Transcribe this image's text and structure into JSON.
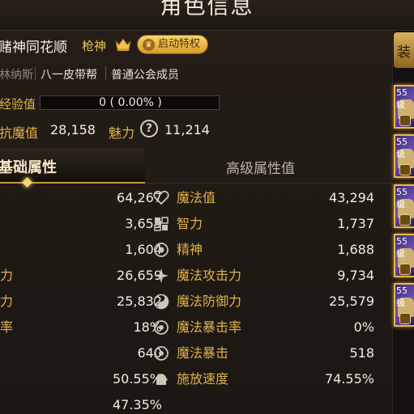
{
  "window": {
    "title": "角色信息"
  },
  "profile": {
    "name": "赌神同花顺",
    "job": "枪神",
    "start_button": "启动特权",
    "tags": [
      "林纳斯",
      "八一皮带帮",
      "普通公会成员"
    ]
  },
  "exp": {
    "label": "经验值",
    "value": "0 ( 0.00% )",
    "progress": 0.0
  },
  "stats": {
    "anti_magic_label": "抗魔值",
    "anti_magic_value": "28,158",
    "charm_label": "魅力",
    "charm_value": "11,214"
  },
  "tabs": {
    "basic": "基础属性",
    "advanced": "高级属性值"
  },
  "left_attrs": [
    {
      "label": "",
      "value": "64,267"
    },
    {
      "label": "",
      "value": "3,659"
    },
    {
      "label": "",
      "value": "1,604"
    },
    {
      "label": "力",
      "value": "26,659"
    },
    {
      "label": "力",
      "value": "25,832"
    },
    {
      "label": "率",
      "value": "18%"
    },
    {
      "label": "",
      "value": "640"
    },
    {
      "label": "",
      "value": "50.55%"
    },
    {
      "label": "",
      "value": "47.35%"
    }
  ],
  "right_attrs": [
    {
      "icon": "heart-icon",
      "label": "魔法值",
      "value": "43,294"
    },
    {
      "icon": "intelligence-icon",
      "label": "智力",
      "value": "1,737"
    },
    {
      "icon": "spirit-icon",
      "label": "精神",
      "value": "1,688"
    },
    {
      "icon": "magic-attack-icon",
      "label": "魔法攻击力",
      "value": "9,734"
    },
    {
      "icon": "magic-defense-icon",
      "label": "魔法防御力",
      "value": "25,579"
    },
    {
      "icon": "crit-rate-icon",
      "label": "魔法暴击率",
      "value": "0%"
    },
    {
      "icon": "crit-icon",
      "label": "魔法暴击",
      "value": "518"
    },
    {
      "icon": "cast-speed-icon",
      "label": "施放速度",
      "value": "74.55%"
    }
  ],
  "side": {
    "top_label": "装",
    "cards": [
      {
        "level": "55级"
      },
      {
        "level": "55级"
      },
      {
        "level": "55级"
      },
      {
        "level": "55级"
      },
      {
        "level": "55级"
      }
    ]
  },
  "colors": {
    "accent": "#e0b24c",
    "background": "#1f1914",
    "button": "#e8b847"
  }
}
